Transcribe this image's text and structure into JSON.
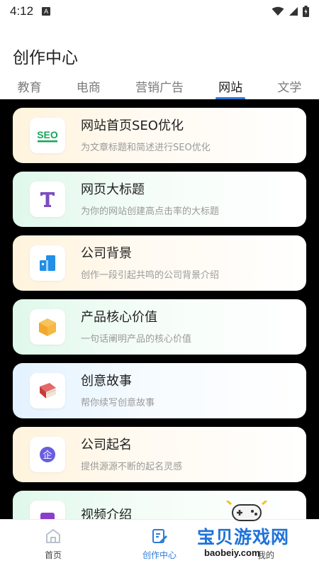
{
  "status_bar": {
    "time": "4:12",
    "notification_badge": "A"
  },
  "page_title": "创作中心",
  "tabs": [
    {
      "label": "教育",
      "active": false
    },
    {
      "label": "电商",
      "active": false
    },
    {
      "label": "营销广告",
      "active": false
    },
    {
      "label": "网站",
      "active": true
    },
    {
      "label": "文学",
      "active": false
    }
  ],
  "cards": [
    {
      "title": "网站首页SEO优化",
      "subtitle": "为文章标题和简述进行SEO优化",
      "icon": "seo-icon",
      "icon_text": "SEO",
      "color": "#1aa35a"
    },
    {
      "title": "网页大标题",
      "subtitle": "为你的网站创建高点击率的大标题",
      "icon": "letter-t-icon",
      "icon_text": "T",
      "color": "#7a4cc2"
    },
    {
      "title": "公司背景",
      "subtitle": "创作一段引起共鸣的公司背景介绍",
      "icon": "building-icon",
      "color": "#1f8fe8"
    },
    {
      "title": "产品核心价值",
      "subtitle": "一句话阐明产品的核心价值",
      "icon": "box-icon",
      "color": "#f2b23a"
    },
    {
      "title": "创意故事",
      "subtitle": "帮你续写创意故事",
      "icon": "book-icon",
      "color": "#d94b4b"
    },
    {
      "title": "公司起名",
      "subtitle": "提供源源不断的起名灵感",
      "icon": "company-name-icon",
      "icon_text": "企",
      "color": "#6a5de0"
    },
    {
      "title": "视频介绍",
      "subtitle": "",
      "icon": "video-icon",
      "color": "#8a3ec9"
    }
  ],
  "bottom_nav": [
    {
      "label": "首页",
      "icon": "home-icon",
      "active": false
    },
    {
      "label": "创作中心",
      "icon": "edit-icon",
      "active": true
    },
    {
      "label": "我的",
      "icon": "profile-icon",
      "active": false
    }
  ],
  "watermark": {
    "text": "宝贝游戏网",
    "url": "baobeiy.com"
  },
  "accent_color": "#2f7bd8"
}
